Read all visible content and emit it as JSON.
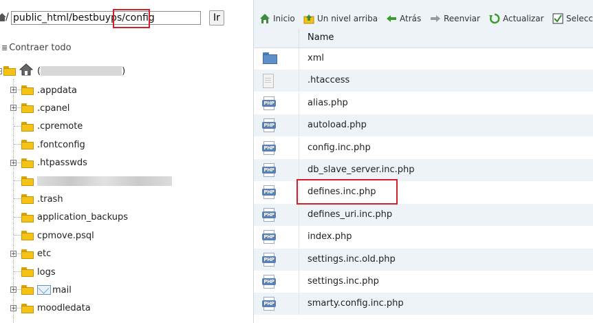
{
  "path_bar": {
    "value": "public_html/bestbuyps/config",
    "go_label": "Ir",
    "prefix": "/"
  },
  "tree": {
    "collapse_label": "Contraer todo",
    "root_open": "(",
    "root_close": ")",
    "items": [
      {
        "label": ".appdata",
        "expandable": true
      },
      {
        "label": ".cpanel",
        "expandable": true
      },
      {
        "label": ".cpremote",
        "expandable": false
      },
      {
        "label": ".fontconfig",
        "expandable": false
      },
      {
        "label": ".htpasswds",
        "expandable": true
      },
      {
        "label": "",
        "expandable": false,
        "redacted": true
      },
      {
        "label": ".trash",
        "expandable": false
      },
      {
        "label": "application_backups",
        "expandable": false
      },
      {
        "label": "cpmove.psql",
        "expandable": false
      },
      {
        "label": "etc",
        "expandable": true
      },
      {
        "label": "logs",
        "expandable": false
      },
      {
        "label": "mail",
        "expandable": true,
        "mail": true
      },
      {
        "label": "moodledata",
        "expandable": true
      }
    ]
  },
  "toolbar": {
    "home": "Inicio",
    "up": "Un nivel arriba",
    "back": "Atrás",
    "forward": "Reenviar",
    "refresh": "Actualizar",
    "select": "Selecc"
  },
  "files": {
    "header_name": "Name",
    "rows": [
      {
        "name": "xml",
        "type": "folder"
      },
      {
        "name": ".htaccess",
        "type": "file"
      },
      {
        "name": "alias.php",
        "type": "php"
      },
      {
        "name": "autoload.php",
        "type": "php"
      },
      {
        "name": "config.inc.php",
        "type": "php"
      },
      {
        "name": "db_slave_server.inc.php",
        "type": "php"
      },
      {
        "name": "defines.inc.php",
        "type": "php"
      },
      {
        "name": "defines_uri.inc.php",
        "type": "php"
      },
      {
        "name": "index.php",
        "type": "php"
      },
      {
        "name": "settings.inc.old.php",
        "type": "php"
      },
      {
        "name": "settings.inc.php",
        "type": "php"
      },
      {
        "name": "smarty.config.inc.php",
        "type": "php"
      }
    ],
    "php_icon_text": "PHP"
  },
  "colors": {
    "highlight": "#d0202a",
    "row_alt": "#eef3f8",
    "folder": "#f4c316"
  }
}
